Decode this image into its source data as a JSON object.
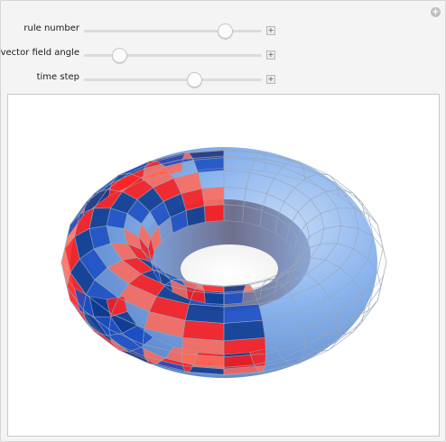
{
  "controls": [
    {
      "label": "rule number",
      "value_fraction": 0.79
    },
    {
      "label": "vector field angle",
      "value_fraction": 0.2
    },
    {
      "label": "time step",
      "value_fraction": 0.62
    }
  ],
  "icons": {
    "corner": "plus-circle-icon",
    "expand": "plus-square-icon"
  },
  "colors": {
    "red": "#ff1a1a",
    "blue": "#1c4fc4",
    "torus": "#8ab4ee"
  }
}
